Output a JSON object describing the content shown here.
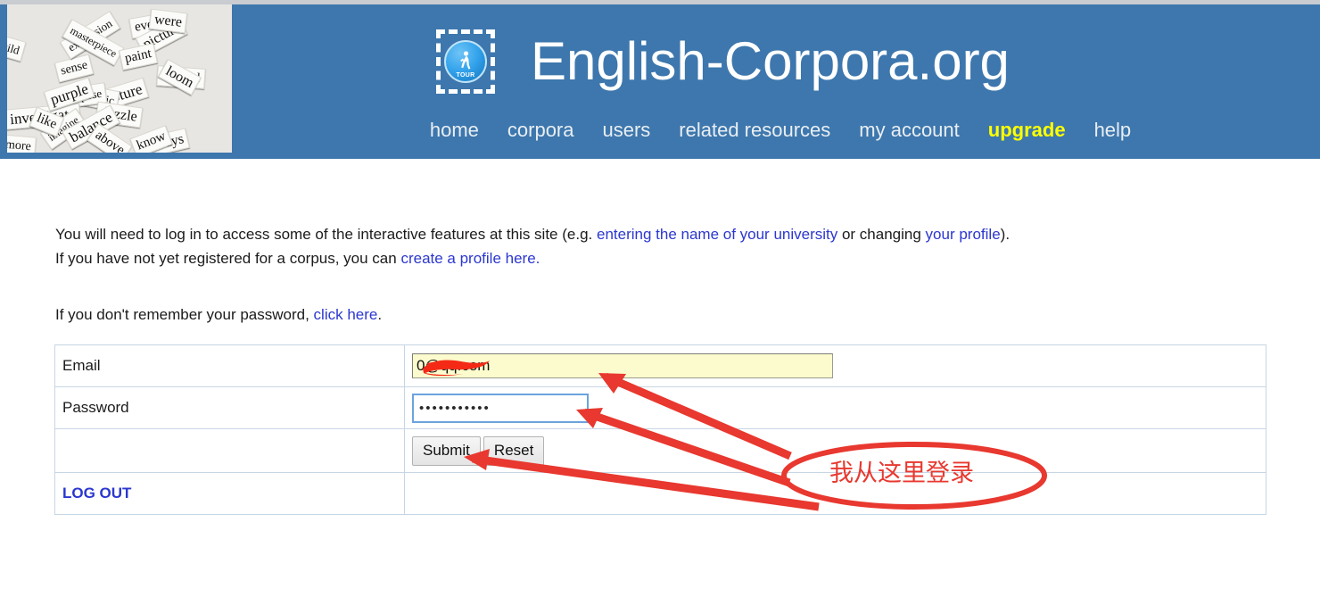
{
  "header": {
    "site_title": "English-Corpora.org",
    "logo_icon": "tour-walking-icon",
    "logo_label": "TOUR",
    "collage_alt": "word-scraps-collage",
    "collage_words": [
      "original",
      "capture",
      "sense",
      "every",
      "expression",
      "electric",
      "loom",
      "always",
      "picture",
      "masterpiece",
      "paint",
      "compose",
      "investigate",
      "dazzle",
      "imagine",
      "balance",
      "like",
      "were",
      "more",
      "wild",
      "above",
      "know",
      "purple"
    ],
    "nav": [
      {
        "label": "home",
        "highlight": false
      },
      {
        "label": "corpora",
        "highlight": false
      },
      {
        "label": "users",
        "highlight": false
      },
      {
        "label": "related resources",
        "highlight": false
      },
      {
        "label": "my account",
        "highlight": false
      },
      {
        "label": "upgrade",
        "highlight": true
      },
      {
        "label": "help",
        "highlight": false
      }
    ]
  },
  "body": {
    "intro_line1_a": "You will need to log in to access some of the interactive features at this site (e.g. ",
    "intro_link_university": "entering the name of your university",
    "intro_line1_b": " or changing ",
    "intro_link_profile": "your profile",
    "intro_line1_c": ").",
    "intro_line2_a": "If you have not yet registered for a corpus, you can ",
    "intro_link_create": "create a profile here.",
    "forgot_a": "If you don't remember your password, ",
    "forgot_link": "click here",
    "forgot_b": "."
  },
  "form": {
    "email_label": "Email",
    "email_value": "0@qq.com",
    "email_redacted": true,
    "password_label": "Password",
    "password_value": "•••••••••••",
    "submit_label": "Submit",
    "reset_label": "Reset",
    "logout_label": "LOG OUT"
  },
  "annotation": {
    "note_text": "我从这里登录",
    "color": "#e8382f",
    "arrow_targets": [
      "email-field",
      "password-field",
      "submit-button"
    ]
  },
  "colors": {
    "header_blue": "#3d77ad",
    "nav_highlight": "#ffff00",
    "link_blue": "#2b37cf",
    "annotation_red": "#e8382f",
    "email_autofill": "#fbfbcd",
    "password_focus_border": "#6ba3dd"
  }
}
